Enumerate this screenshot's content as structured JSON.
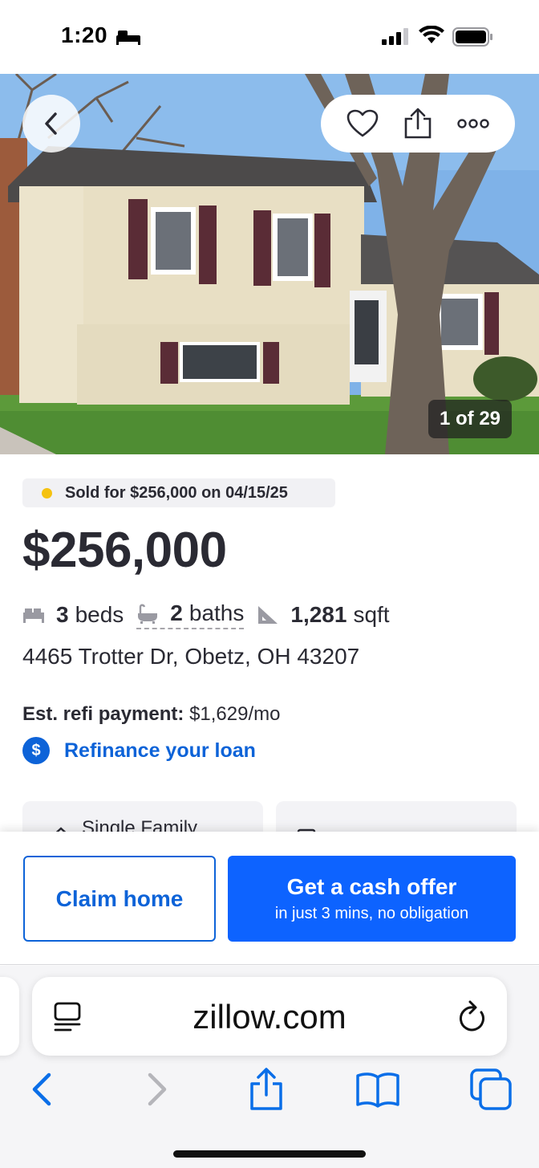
{
  "status_bar": {
    "time": "1:20"
  },
  "hero": {
    "photo_counter": "1 of 29"
  },
  "listing": {
    "sold_label": "Sold for $256,000 on 04/15/25",
    "price": "$256,000",
    "beds_value": "3",
    "beds_label": "beds",
    "baths_value": "2",
    "baths_label": "baths",
    "sqft_value": "1,281",
    "sqft_label": "sqft",
    "address": "4465 Trotter Dr, Obetz, OH 43207",
    "refi_label": "Est. refi payment:",
    "refi_value": "$1,629/mo",
    "refi_link": "Refinance your loan",
    "refi_link_icon": "$",
    "card1_text": "Single Family"
  },
  "cta": {
    "claim_label": "Claim home",
    "offer_label": "Get a cash offer",
    "offer_sub": "in just 3 mins, no obligation"
  },
  "browser": {
    "url": "zillow.com"
  },
  "colors": {
    "brand_blue": "#0d63d8",
    "cta_blue": "#0d63ff",
    "sold_dot": "#f5c211"
  }
}
